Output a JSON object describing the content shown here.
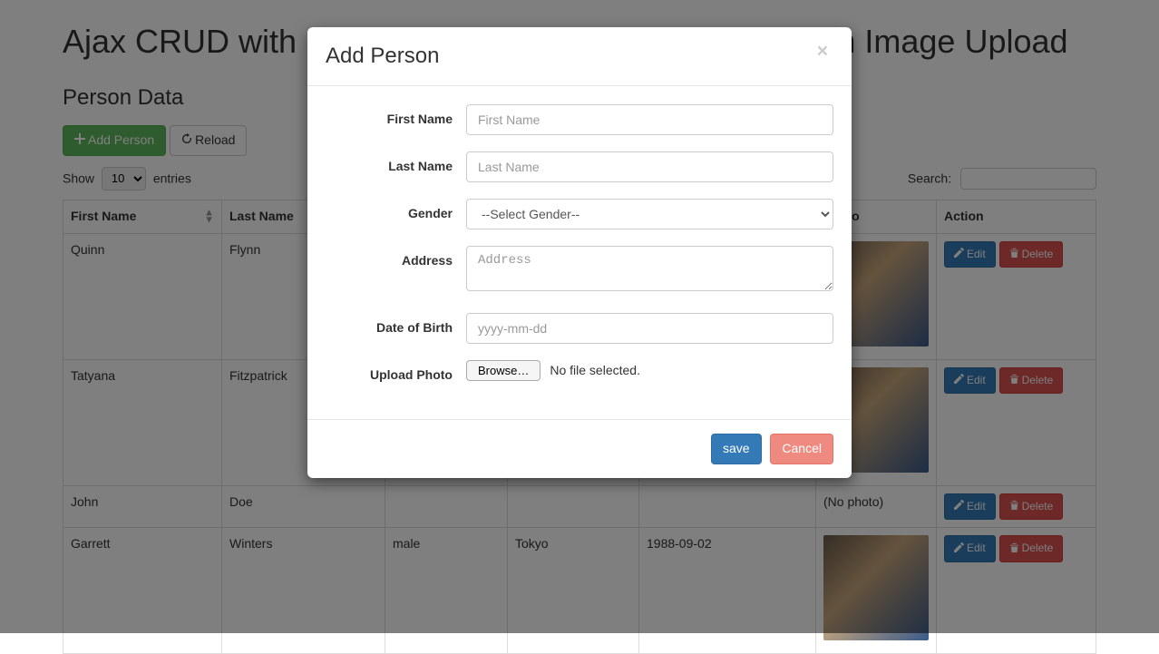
{
  "page": {
    "title": "Ajax CRUD with Bootstrap modals and Datatables with Image Upload",
    "subtitle": "Person Data"
  },
  "toolbar": {
    "add_label": "Add Person",
    "reload_label": "Reload"
  },
  "datatable": {
    "show_label": "Show",
    "entries_label": "entries",
    "page_size": "10",
    "search_label": "Search:",
    "columns": {
      "first_name": "First Name",
      "last_name": "Last Name",
      "gender": "",
      "address": "",
      "dob": "",
      "photo": "Photo",
      "action": "Action"
    },
    "actions": {
      "edit_label": "Edit",
      "delete_label": "Delete"
    },
    "no_photo_text": "(No photo)",
    "rows": [
      {
        "first_name": "Quinn",
        "last_name": "Flynn",
        "gender": "",
        "address": "",
        "dob": "",
        "has_photo": true
      },
      {
        "first_name": "Tatyana",
        "last_name": "Fitzpatrick",
        "gender": "",
        "address": "",
        "dob": "",
        "has_photo": true
      },
      {
        "first_name": "John",
        "last_name": "Doe",
        "gender": "",
        "address": "",
        "dob": "",
        "has_photo": false
      },
      {
        "first_name": "Garrett",
        "last_name": "Winters",
        "gender": "male",
        "address": "Tokyo",
        "dob": "1988-09-02",
        "has_photo": true
      }
    ]
  },
  "modal": {
    "title": "Add Person",
    "fields": {
      "first_name": {
        "label": "First Name",
        "placeholder": "First Name"
      },
      "last_name": {
        "label": "Last Name",
        "placeholder": "Last Name"
      },
      "gender": {
        "label": "Gender",
        "placeholder": "--Select Gender--"
      },
      "address": {
        "label": "Address",
        "placeholder": "Address"
      },
      "dob": {
        "label": "Date of Birth",
        "placeholder": "yyyy-mm-dd"
      },
      "photo": {
        "label": "Upload Photo",
        "browse": "Browse…",
        "status": "No file selected."
      }
    },
    "footer": {
      "save": "save",
      "cancel": "Cancel"
    }
  }
}
